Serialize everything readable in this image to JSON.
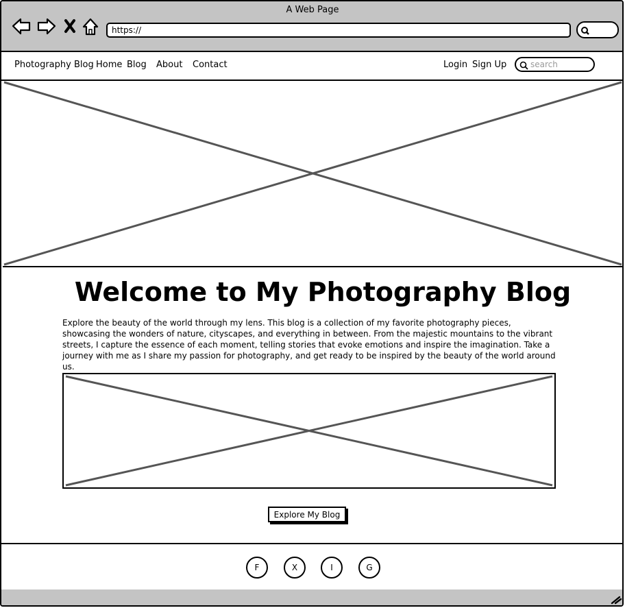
{
  "window": {
    "title": "A Web Page"
  },
  "browser": {
    "url": "https://",
    "icons": [
      "back-arrow-icon",
      "forward-arrow-icon",
      "close-x-icon",
      "home-icon",
      "search-icon"
    ]
  },
  "site_nav": {
    "brand": "Photography Blog",
    "links": [
      "Home",
      "Blog",
      "About",
      "Contact"
    ],
    "login": "Login",
    "signup": "Sign Up",
    "search_placeholder": "search"
  },
  "main": {
    "title": "Welcome to My Photography Blog",
    "intro": "Explore the beauty of the world through my lens. This blog is a collection of my favorite photography pieces, showcasing the wonders of nature, cityscapes, and everything in between. From the majestic mountains to the vibrant streets, I capture the essence of each moment, telling stories that evoke emotions and inspire the imagination. Take a journey with me as I share my passion for photography, and get ready to be inspired by the beauty of the world around us.",
    "cta": "Explore My Blog"
  },
  "footer": {
    "social": [
      "F",
      "X",
      "I",
      "G"
    ]
  },
  "colors": {
    "chrome": "#c4c4c4",
    "placeholder_lines": "#555555",
    "border": "#000000"
  }
}
